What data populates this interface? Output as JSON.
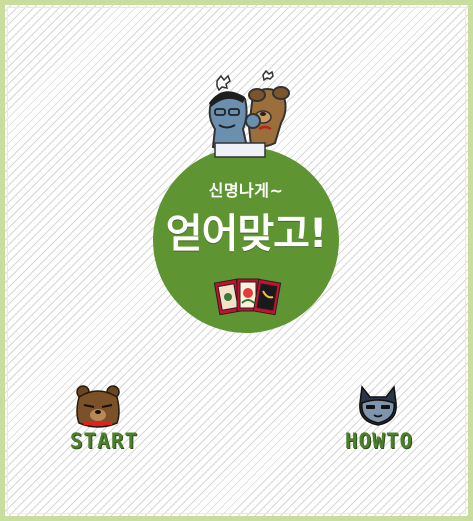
{
  "title": {
    "subtitle": "신명나게~",
    "main": "얻어맞고!"
  },
  "menu": {
    "start_label": "START",
    "howto_label": "HOWTO"
  },
  "colors": {
    "circle": "#5e9431",
    "label": "#4c7f2c",
    "border": "#c9de9c"
  },
  "icons": {
    "characters": "fighting-characters-icon",
    "cards": "hwatu-cards-icon",
    "start": "bear-face-icon",
    "howto": "cat-face-icon"
  }
}
